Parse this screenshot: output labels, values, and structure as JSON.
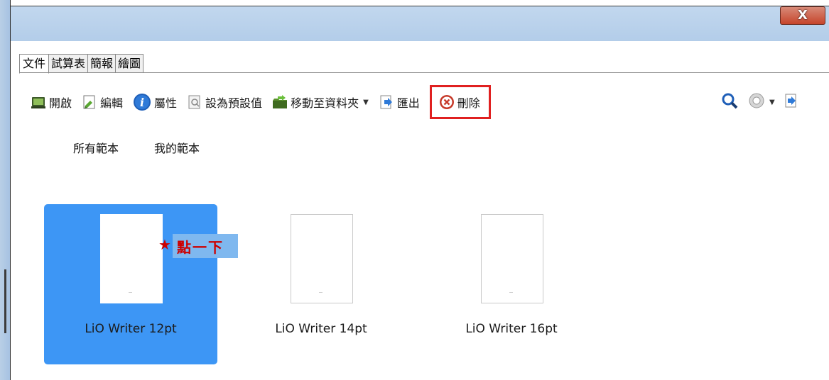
{
  "window": {
    "close_label": "X"
  },
  "tabs": [
    {
      "label": "文件",
      "active": true
    },
    {
      "label": "試算表",
      "active": false
    },
    {
      "label": "簡報",
      "active": false
    },
    {
      "label": "繪圖",
      "active": false
    }
  ],
  "toolbar": {
    "open": "開啟",
    "edit": "編輯",
    "properties": "屬性",
    "set_default": "設為預設值",
    "move_to_folder": "移動至資料夾",
    "export": "匯出",
    "delete": "刪除"
  },
  "subtabs": {
    "all": "所有範本",
    "mine": "我的範本"
  },
  "templates": [
    {
      "name": "LiO Writer 12pt",
      "selected": true
    },
    {
      "name": "LiO Writer 14pt",
      "selected": false
    },
    {
      "name": "LiO Writer 16pt",
      "selected": false
    }
  ],
  "annotation": {
    "star": "★",
    "text": "點一下"
  },
  "colors": {
    "selection": "#3d96f5",
    "highlight_box": "#e02020",
    "annotation_text": "#cc0000"
  }
}
